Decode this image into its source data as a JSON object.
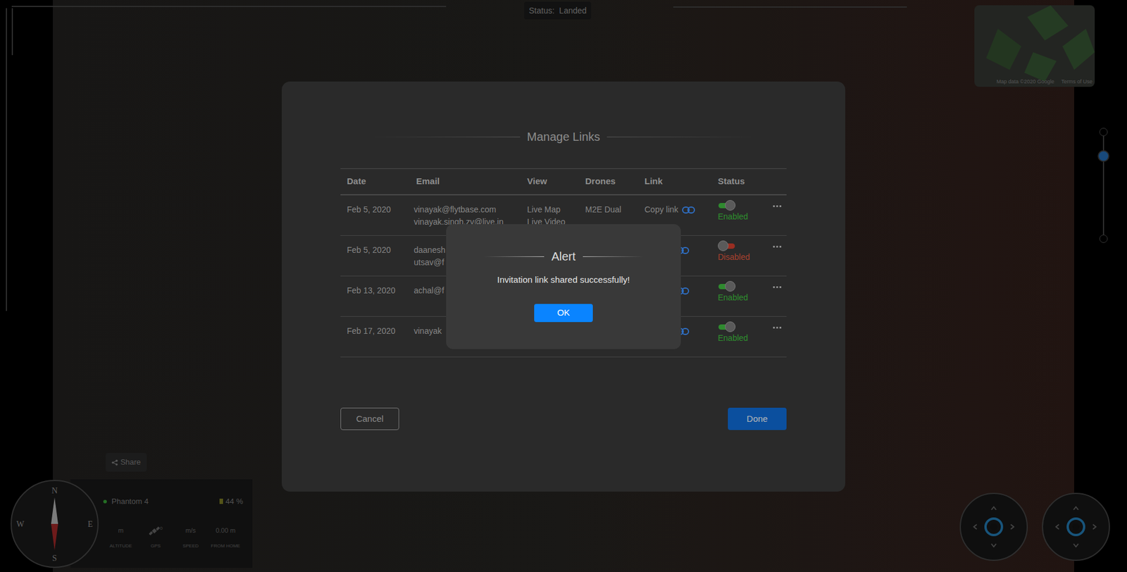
{
  "status": {
    "label": "Status:",
    "value": "Landed"
  },
  "map": {
    "attribution": "Map data ©2020 Google",
    "terms": "Terms of Use"
  },
  "zoom": {
    "level": 0.8
  },
  "dialog": {
    "title": "Manage Links",
    "columns": [
      "Date",
      "Email",
      "View",
      "Drones",
      "Link",
      "Status"
    ],
    "rows": [
      {
        "date": "Feb 5, 2020",
        "emails": [
          "vinayak@flytbase.com",
          "vinayak.singh.zv@live.in"
        ],
        "views": [
          "Live Map",
          "Live Video"
        ],
        "drones": "M2E Dual",
        "link": "Copy link",
        "enabled": true,
        "status": "Enabled"
      },
      {
        "date": "Feb 5, 2020",
        "emails": [
          "daanesh",
          "utsav@f"
        ],
        "views": [],
        "drones": "",
        "link": "",
        "enabled": false,
        "status": "Disabled"
      },
      {
        "date": "Feb 13, 2020",
        "emails": [
          "achal@f"
        ],
        "views": [],
        "drones": "",
        "link": "",
        "enabled": true,
        "status": "Enabled"
      },
      {
        "date": "Feb 17, 2020",
        "emails": [
          "vinayak"
        ],
        "views": [],
        "drones": "",
        "link": "",
        "enabled": true,
        "status": "Enabled"
      }
    ],
    "buttons": {
      "cancel": "Cancel",
      "done": "Done"
    }
  },
  "alert": {
    "title": "Alert",
    "message": "Invitation link shared successfully!",
    "button": "OK"
  },
  "share_button": "Share",
  "telemetry": {
    "drone": "Phantom 4",
    "connected": true,
    "battery": "44 %",
    "readings": [
      {
        "value": "m",
        "label": "ALTITUDE",
        "kind": "text"
      },
      {
        "value": "0",
        "label": "GPS",
        "kind": "gps"
      },
      {
        "value": "m/s",
        "label": "SPEED",
        "kind": "text"
      },
      {
        "value": "0.00 m",
        "label": "FROM HOME",
        "kind": "text"
      }
    ]
  },
  "compass": {
    "n": "N",
    "e": "E",
    "s": "S",
    "w": "W"
  }
}
